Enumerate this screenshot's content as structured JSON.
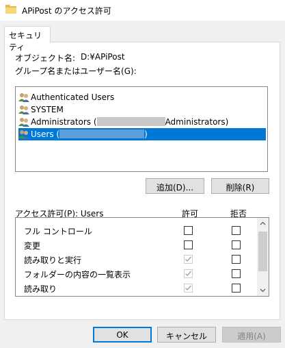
{
  "window": {
    "title": "APiPost のアクセス許可"
  },
  "tabs": [
    {
      "label": "セキュリティ"
    }
  ],
  "object": {
    "label": "オブジェクト名:",
    "value": "D:¥APiPost"
  },
  "group_label": "グループ名またはユーザー名(G):",
  "principals": [
    {
      "name": "Authenticated Users",
      "redacted": false,
      "selected": false
    },
    {
      "name": "SYSTEM",
      "redacted": false,
      "selected": false
    },
    {
      "prefix": "Administrators (",
      "suffix": "Administrators)",
      "redacted": true,
      "selected": false
    },
    {
      "prefix": "Users (",
      "suffix": ")",
      "redacted": true,
      "selected": true
    }
  ],
  "buttons": {
    "add": "追加(D)...",
    "remove": "削除(R)",
    "ok": "OK",
    "cancel": "キャンセル",
    "apply": "適用(A)"
  },
  "permissions": {
    "header": "アクセス許可(P): Users",
    "allow_header": "許可",
    "deny_header": "拒否",
    "rows": [
      {
        "name": "フル コントロール",
        "allow": false,
        "allow_inherited": false,
        "deny": false
      },
      {
        "name": "変更",
        "allow": false,
        "allow_inherited": false,
        "deny": false
      },
      {
        "name": "読み取りと実行",
        "allow": true,
        "allow_inherited": true,
        "deny": false
      },
      {
        "name": "フォルダーの内容の一覧表示",
        "allow": true,
        "allow_inherited": true,
        "deny": false
      },
      {
        "name": "読み取り",
        "allow": true,
        "allow_inherited": true,
        "deny": false
      }
    ]
  },
  "colors": {
    "selection": "#0078d7",
    "dialog_bg": "#f0f0f0",
    "button_bg": "#e1e1e1"
  },
  "icons": {
    "window": "folder-icon",
    "principal": "users-group-icon"
  }
}
